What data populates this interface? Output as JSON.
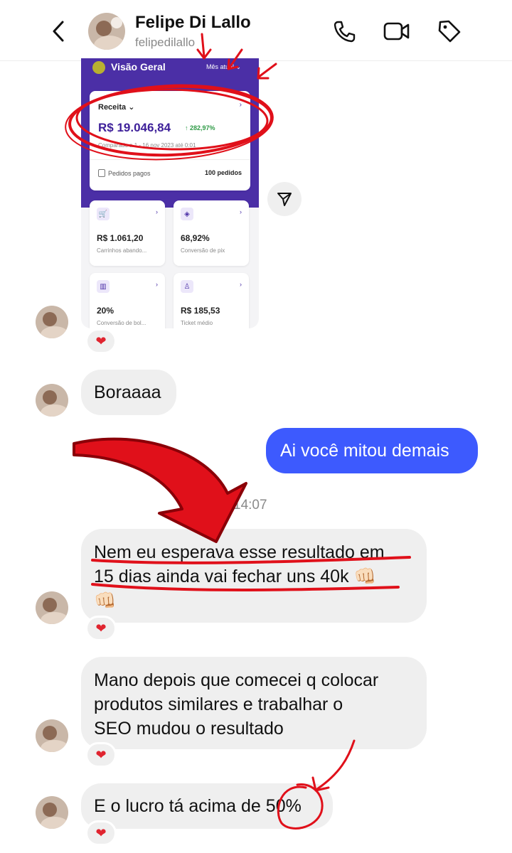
{
  "header": {
    "name": "Felipe Di Lallo",
    "username": "felipedilallo"
  },
  "shared_screenshot": {
    "title": "Visão Geral",
    "period": "Mês atual ⌄",
    "main_card": {
      "label": "Receita ⌄",
      "arrow": "›",
      "value": "R$ 19.046,84",
      "growth": "↑ 282,97%",
      "comparison": "Comparado a 1 - 16 nov 2023 até 0:01",
      "paid_label": "Pedidos pagos",
      "paid_value": "100 pedidos"
    },
    "tiles": [
      {
        "value": "R$ 1.061,20",
        "label": "Carrinhos abando...",
        "icon": "cart-icon",
        "glyph": "🛒"
      },
      {
        "value": "68,92%",
        "label": "Conversão de pix",
        "icon": "pix-icon",
        "glyph": "◈"
      },
      {
        "value": "20%",
        "label": "Conversão de bol...",
        "icon": "barcode-icon",
        "glyph": "▥"
      },
      {
        "value": "R$ 185,53",
        "label": "Ticket médio",
        "icon": "person-icon",
        "glyph": "♙"
      }
    ]
  },
  "messages": {
    "m1": "Boraaaa",
    "m2": "Ai você mitou demais",
    "time": "14:07",
    "m3_line1": "Nem eu esperava esse resultado em",
    "m3_line2": "15 dias ainda vai fechar uns 40k 👊🏻",
    "m3_line3": "👊🏻",
    "m4_line1": "Mano depois que comecei q colocar",
    "m4_line2": "produtos similares e trabalhar o",
    "m4_line3": "SEO mudou o resultado",
    "m5": "E o lucro tá acima de 50%"
  },
  "reaction_glyph": "❤",
  "colors": {
    "my_bubble": "#3d5afe",
    "their_bubble": "#efefef",
    "dashboard_purple": "#4b2fa6",
    "annotation_red": "#e0101a"
  }
}
